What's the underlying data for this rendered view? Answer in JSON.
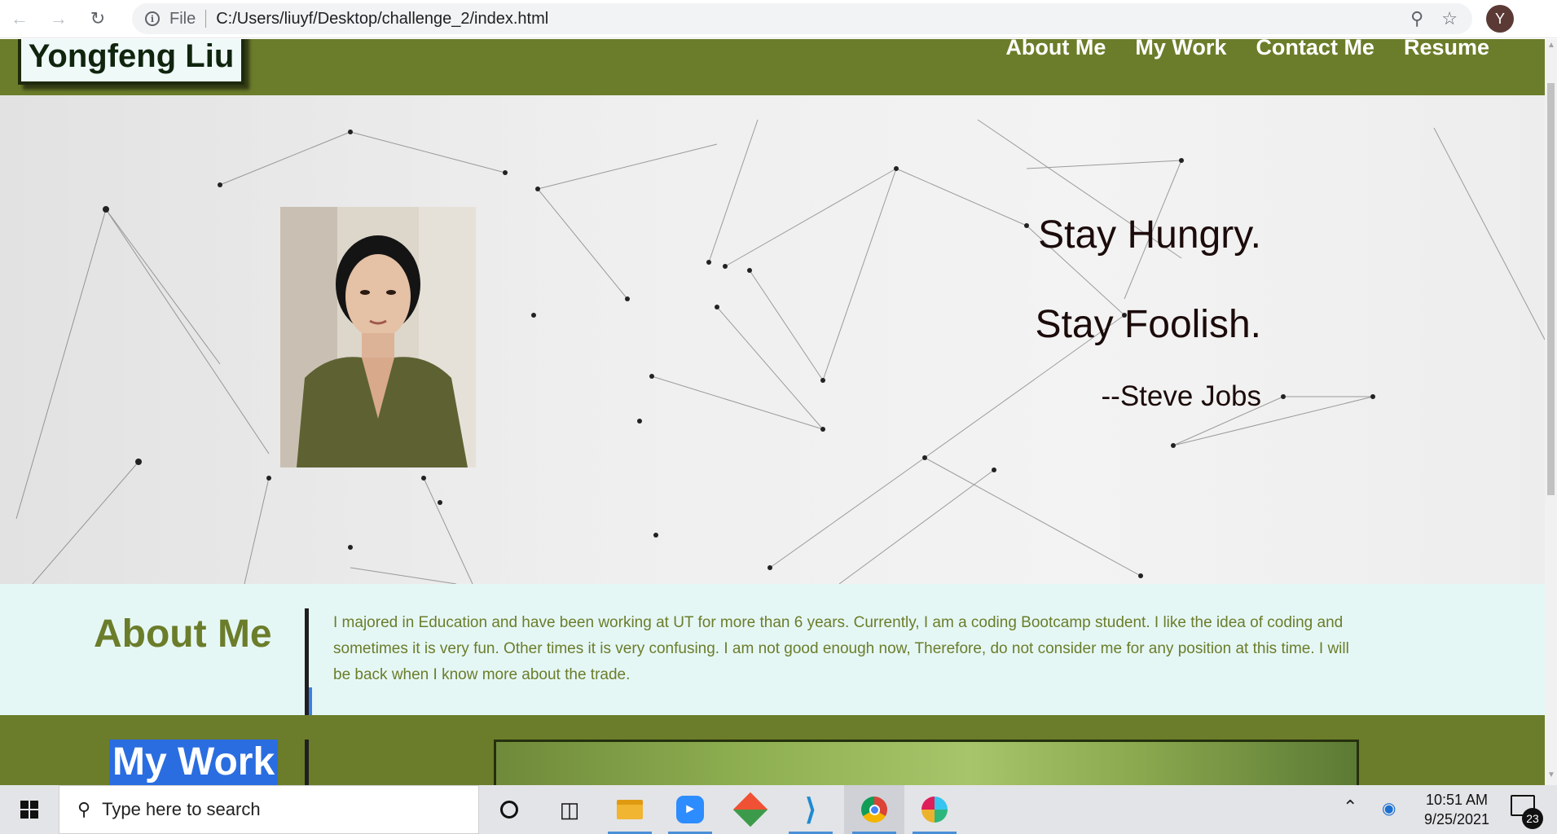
{
  "browser": {
    "scheme_label": "File",
    "url": "C:/Users/liuyf/Desktop/challenge_2/index.html",
    "profile_initial": "Y"
  },
  "site": {
    "logo": "Yongfeng Liu",
    "nav": [
      {
        "label": "About Me"
      },
      {
        "label": "My Work"
      },
      {
        "label": "Contact Me"
      },
      {
        "label": "Resume"
      }
    ],
    "hero": {
      "quote_line_1": "Stay Hungry.",
      "quote_line_2": "Stay Foolish.",
      "quote_author": "--Steve Jobs"
    },
    "about": {
      "title": "About Me",
      "text": "I majored in Education and have been working at UT for more than 6 years. Currently, I am a coding Bootcamp student. I like the idea of coding and sometimes it is very fun. Other times it is very confusing. I am not good enough now, Therefore, do not consider me for any position at this time. I will be back when I know more about the trade."
    },
    "work": {
      "title": "My Work"
    }
  },
  "taskbar": {
    "search_placeholder": "Type here to search",
    "time": "10:51 AM",
    "date": "9/25/2021",
    "notification_count": "23"
  },
  "colors": {
    "header_green": "#6b7d2a",
    "about_bg": "#e5f7f5",
    "highlight_blue": "#2a6de0",
    "quote_text": "#1c0b0b"
  }
}
